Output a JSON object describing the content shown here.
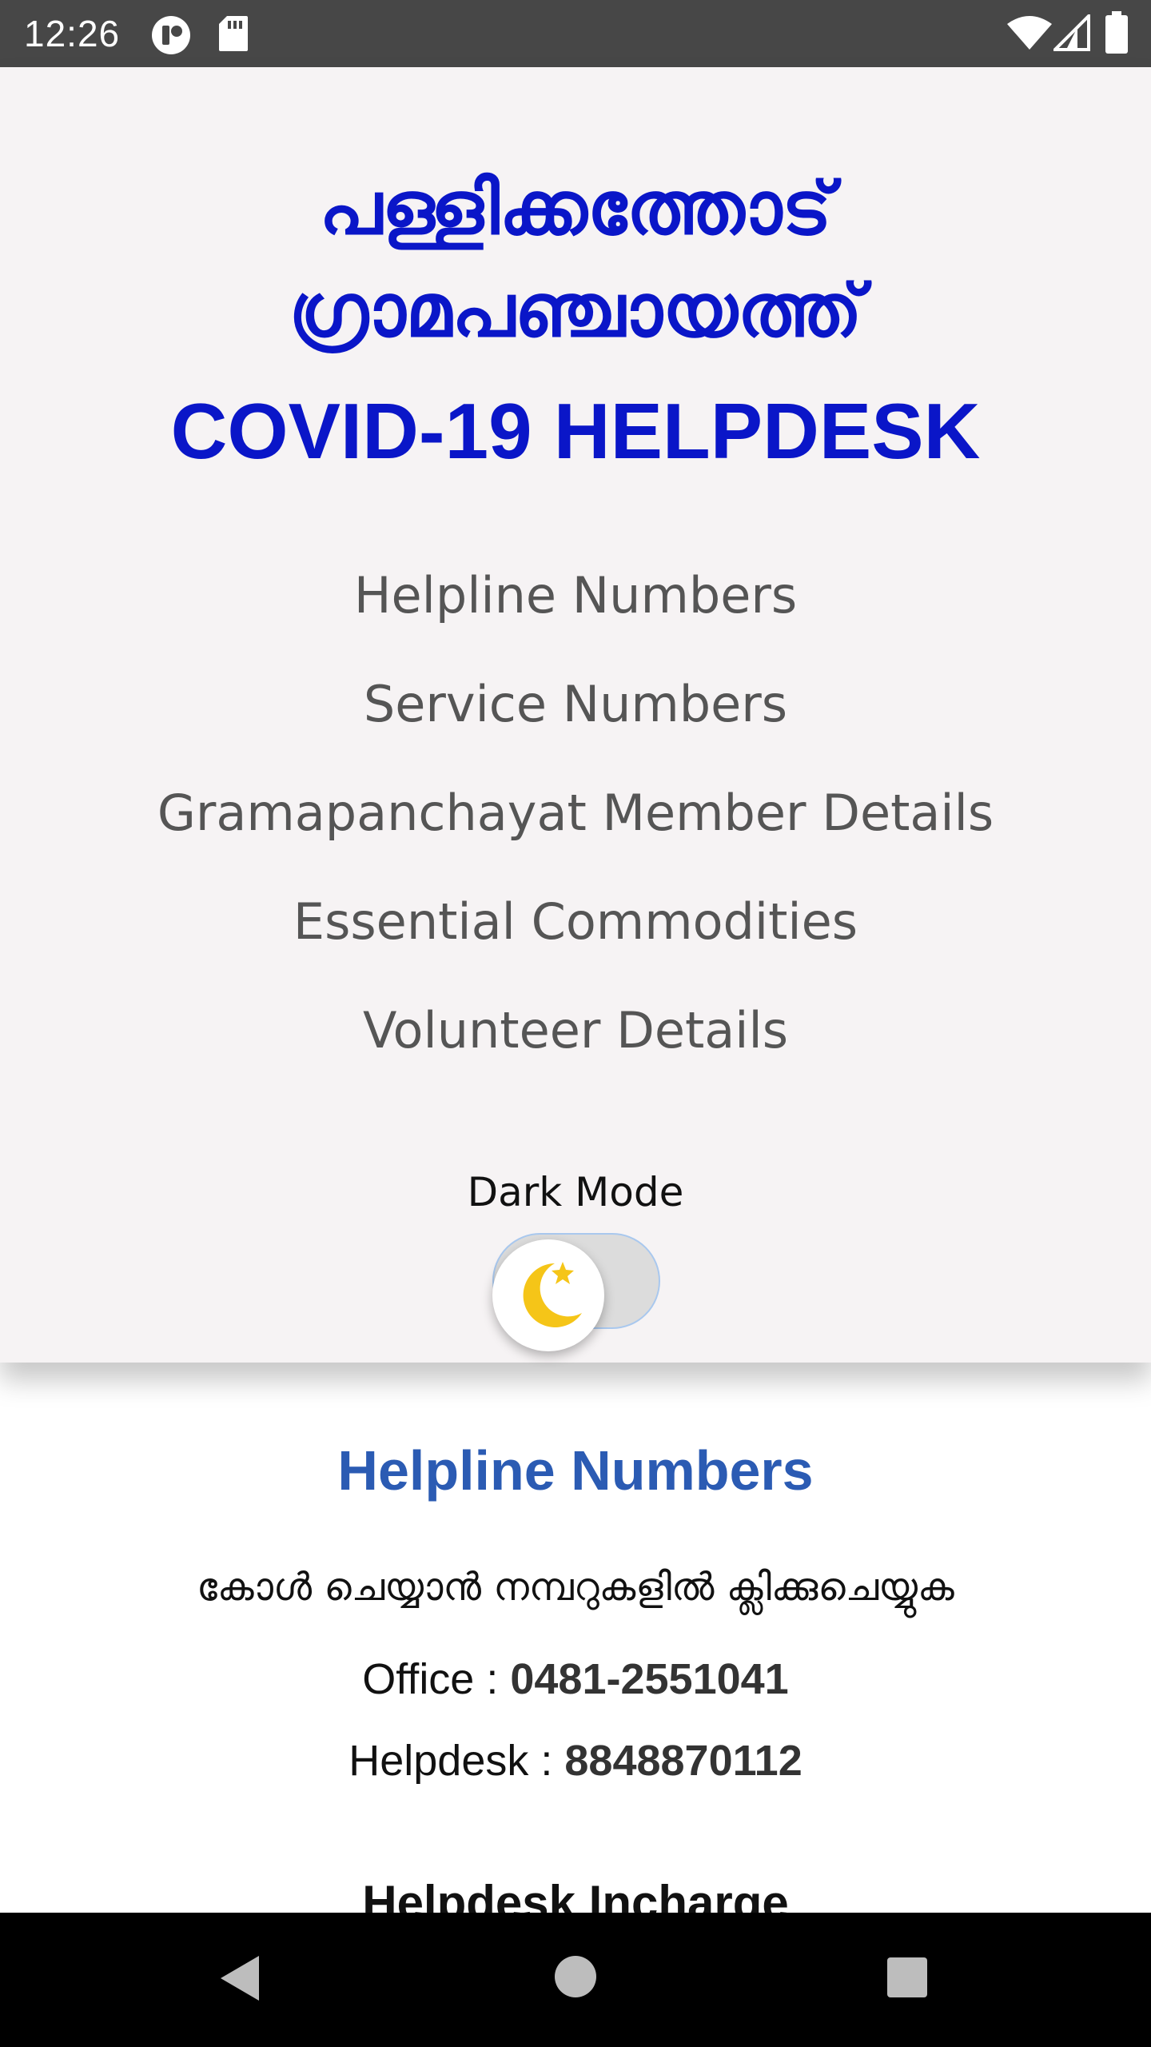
{
  "status_bar": {
    "time": "12:26",
    "icons": [
      "app-notification-icon",
      "sd-card-icon",
      "wifi-icon",
      "cellular-signal-icon",
      "battery-icon"
    ]
  },
  "header": {
    "title_ml_line1": "പള്ളിക്കത്തോട്",
    "title_ml_line2": "ഗ്രാമപഞ്ചായത്ത്",
    "title_en": "COVID-19 HELPDESK",
    "title_color": "#0a16c8"
  },
  "menu": {
    "items": [
      {
        "label": "Helpline Numbers"
      },
      {
        "label": "Service Numbers"
      },
      {
        "label": "Gramapanchayat Member Details"
      },
      {
        "label": "Essential Commodities"
      },
      {
        "label": "Volunteer Details"
      }
    ]
  },
  "dark_mode": {
    "label": "Dark Mode",
    "enabled": false,
    "knob_icon": "moon-star-icon"
  },
  "helpline": {
    "title": "Helpline Numbers",
    "title_color": "#2b5bb3",
    "instruction": "കോൾ ചെയ്യാൻ നമ്പറുകളിൽ ക്ലിക്കുചെയ്യുക",
    "entries": [
      {
        "label": "Office : ",
        "number": "0481-2551041"
      },
      {
        "label": "Helpdesk : ",
        "number": "8848870112"
      }
    ],
    "next_heading": "Helpdesk Incharge"
  },
  "nav_bar": {
    "buttons": [
      "back-icon",
      "home-icon",
      "recents-icon"
    ]
  }
}
